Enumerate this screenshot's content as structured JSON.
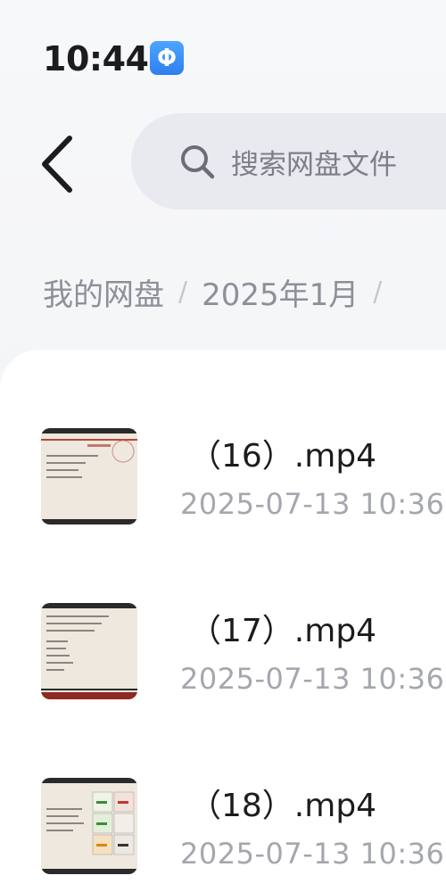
{
  "status_bar": {
    "time": "10:44",
    "app_icon": "shield-app-icon"
  },
  "header": {
    "back_icon": "chevron-left-icon",
    "search": {
      "icon": "search-icon",
      "placeholder": "搜索网盘文件"
    }
  },
  "breadcrumb": {
    "items": [
      "我的网盘",
      "2025年1月"
    ],
    "separator": "/"
  },
  "files": [
    {
      "name": "（16）.mp4",
      "modified": "2025-07-13  10:36"
    },
    {
      "name": "（17）.mp4",
      "modified": "2025-07-13  10:36"
    },
    {
      "name": "（18）.mp4",
      "modified": "2025-07-13  10:36"
    }
  ],
  "colors": {
    "accent": "#2f7df0",
    "text_primary": "#1c1c1e",
    "text_secondary": "#a4a7ae"
  }
}
